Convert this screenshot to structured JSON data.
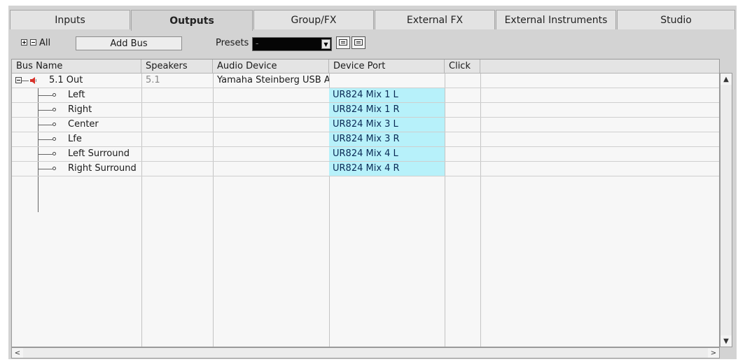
{
  "tabs": [
    "Inputs",
    "Outputs",
    "Group/FX",
    "External FX",
    "External Instruments",
    "Studio"
  ],
  "active_tab": "Outputs",
  "toolbar": {
    "all_label": "All",
    "add_bus_label": "Add Bus",
    "presets_label": "Presets",
    "preset_value": "-"
  },
  "columns": [
    "Bus Name",
    "Speakers",
    "Audio Device",
    "Device Port",
    "Click"
  ],
  "bus": {
    "name": "5.1 Out",
    "speakers": "5.1",
    "device": "Yamaha Steinberg USB A"
  },
  "channels": [
    {
      "name": "Left",
      "port": "UR824 Mix 1 L"
    },
    {
      "name": "Right",
      "port": "UR824 Mix 1 R"
    },
    {
      "name": "Center",
      "port": "UR824 Mix 3 L"
    },
    {
      "name": "Lfe",
      "port": "UR824 Mix 3 R"
    },
    {
      "name": "Left Surround",
      "port": "UR824 Mix 4 L"
    },
    {
      "name": "Right Surround",
      "port": "UR824 Mix 4 R"
    }
  ],
  "icons": {
    "expand_all": "plus-box-icon",
    "collapse_all": "minus-box-icon",
    "speaker": "speaker-icon",
    "save_preset": "save-preset-icon",
    "remove_preset": "remove-preset-icon",
    "scroll_up": "▲",
    "scroll_down": "▼",
    "scroll_left": "<",
    "scroll_right": ">"
  },
  "colors": {
    "port_highlight": "#b7f1fa",
    "speaker_icon": "#d8322a"
  }
}
